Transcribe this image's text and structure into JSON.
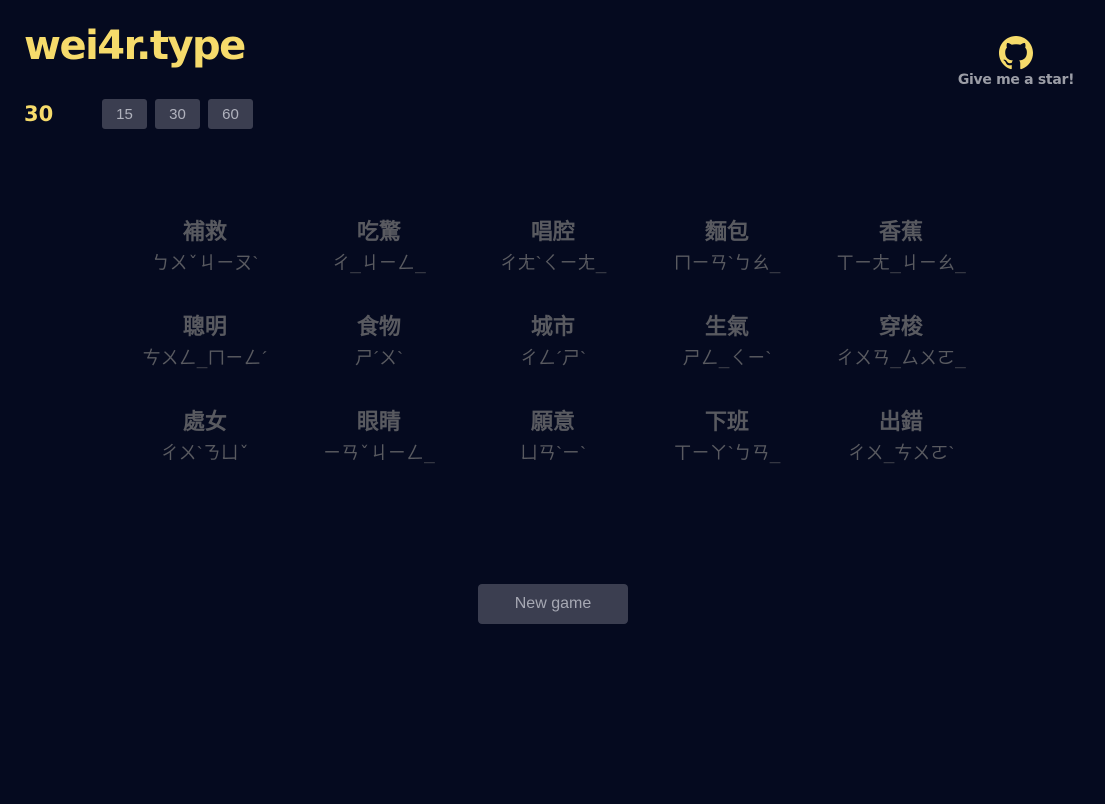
{
  "app": {
    "title": "wei4r.type"
  },
  "timer": {
    "remaining": "30"
  },
  "durations": [
    "15",
    "30",
    "60"
  ],
  "github": {
    "icon": "github-icon",
    "label": "Give me a star!",
    "icon_color": "#f6db6b"
  },
  "words": [
    {
      "hanzi": "補救",
      "zhuyin": "ㄅㄨˇㄐㄧㄡˋ"
    },
    {
      "hanzi": "吃驚",
      "zhuyin": "ㄔ_ㄐㄧㄥ_"
    },
    {
      "hanzi": "唱腔",
      "zhuyin": "ㄔㄤˋㄑㄧㄤ_"
    },
    {
      "hanzi": "麵包",
      "zhuyin": "ㄇㄧㄢˋㄅㄠ_"
    },
    {
      "hanzi": "香蕉",
      "zhuyin": "ㄒㄧㄤ_ㄐㄧㄠ_"
    },
    {
      "hanzi": "聰明",
      "zhuyin": "ㄘㄨㄥ_ㄇㄧㄥˊ"
    },
    {
      "hanzi": "食物",
      "zhuyin": "ㄕˊㄨˋ"
    },
    {
      "hanzi": "城市",
      "zhuyin": "ㄔㄥˊㄕˋ"
    },
    {
      "hanzi": "生氣",
      "zhuyin": "ㄕㄥ_ㄑㄧˋ"
    },
    {
      "hanzi": "穿梭",
      "zhuyin": "ㄔㄨㄢ_ㄙㄨㄛ_"
    },
    {
      "hanzi": "處女",
      "zhuyin": "ㄔㄨˋㄋㄩˇ"
    },
    {
      "hanzi": "眼睛",
      "zhuyin": "ㄧㄢˇㄐㄧㄥ_"
    },
    {
      "hanzi": "願意",
      "zhuyin": "ㄩㄢˋㄧˋ"
    },
    {
      "hanzi": "下班",
      "zhuyin": "ㄒㄧㄚˋㄅㄢ_"
    },
    {
      "hanzi": "出錯",
      "zhuyin": "ㄔㄨ_ㄘㄨㄛˋ"
    }
  ],
  "actions": {
    "new_game_label": "New game"
  },
  "colors": {
    "background": "#050a1f",
    "accent": "#f6db6b",
    "button_bg": "#3b3e50",
    "word_text": "#595a60"
  }
}
